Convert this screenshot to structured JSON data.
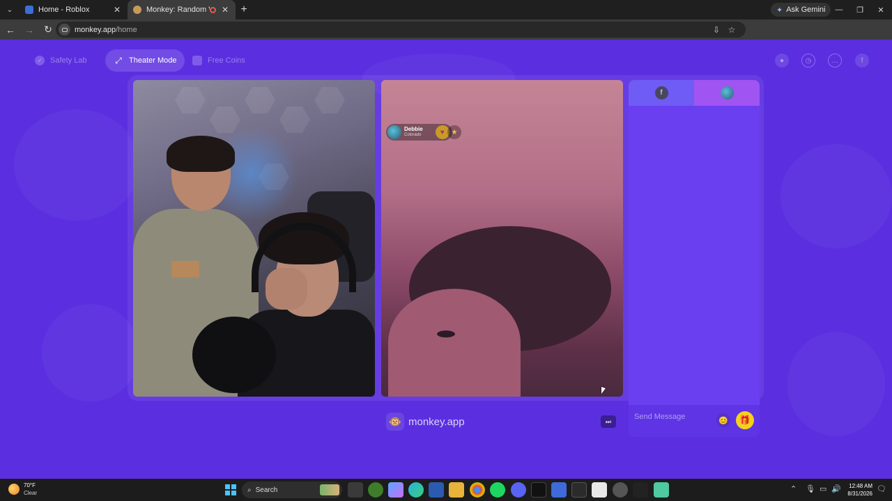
{
  "browser": {
    "tabs": [
      {
        "title": "Home - Roblox",
        "active": false
      },
      {
        "title": "Monkey: Random Video Ch",
        "active": true
      }
    ],
    "new_tab": "+",
    "ask_gemini": "Ask Gemini",
    "url_host": "monkey.app",
    "url_path": "/home",
    "window_controls": {
      "minimize": "—",
      "restore": "❐",
      "close": "✕"
    }
  },
  "topnav": {
    "safety_lab": "Safety Lab",
    "theater_mode": "Theater Mode",
    "free_coins": "Free Coins"
  },
  "remote_user": {
    "name": "Debbie",
    "location": "Colorado"
  },
  "watermark": "monkey.app",
  "chat": {
    "tab_left_icon": "f",
    "placeholder": "Send Message"
  },
  "taskbar": {
    "temperature": "70°F",
    "condition": "Clear",
    "search_label": "Search",
    "time": "12:48 AM",
    "date": "8/31/2026"
  },
  "colors": {
    "page_bg": "#5b2fe0",
    "chat_bg": "#6a3ff0",
    "gift": "#f5d21a"
  }
}
